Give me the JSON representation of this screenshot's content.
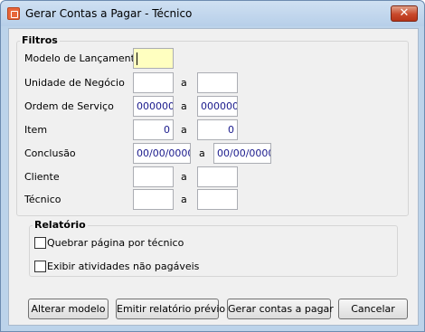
{
  "window": {
    "title": "Gerar Contas a Pagar - Técnico",
    "close_symbol": "✕"
  },
  "filtros": {
    "group_label": "Filtros",
    "separator": "a",
    "modelo_lancamento": {
      "label": "Modelo de Lançamento",
      "value": ""
    },
    "unidade_negocio": {
      "label": "Unidade de Negócio",
      "from": "",
      "to": ""
    },
    "ordem_servico": {
      "label": "Ordem de Serviço",
      "from": "000000",
      "to": "000000"
    },
    "item": {
      "label": "Item",
      "from": "0",
      "to": "0"
    },
    "conclusao": {
      "label": "Conclusão",
      "from": "00/00/0000",
      "to": "00/00/0000"
    },
    "cliente": {
      "label": "Cliente",
      "from": "",
      "to": ""
    },
    "tecnico": {
      "label": "Técnico",
      "from": "",
      "to": ""
    }
  },
  "relatorio": {
    "group_label": "Relatório",
    "quebrar_pagina": {
      "label": "Quebrar página por técnico",
      "checked": false
    },
    "exibir_atividades": {
      "label": "Exibir atividades não pagáveis",
      "checked": false
    }
  },
  "buttons": {
    "alterar_modelo": "Alterar modelo",
    "emitir_relatorio": "Emitir relatório prévio",
    "gerar_contas": "Gerar contas a pagar",
    "cancelar": "Cancelar"
  }
}
